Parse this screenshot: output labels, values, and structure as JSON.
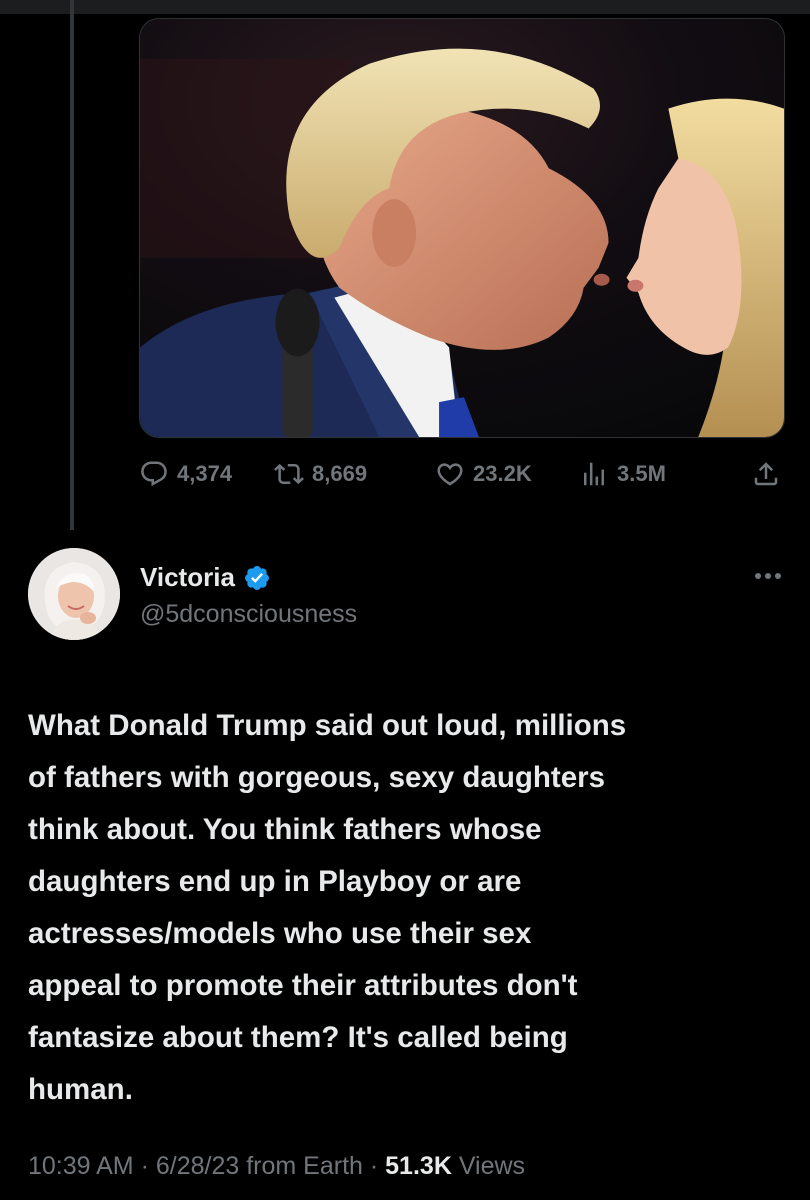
{
  "quoted_tweet": {
    "media": {
      "description_icon": "photo-icon"
    },
    "actions": {
      "replies": "4,374",
      "retweets": "8,669",
      "likes": "23.2K",
      "views": "3.5M"
    }
  },
  "tweet": {
    "author": {
      "display_name": "Victoria",
      "handle": "@5dconsciousness",
      "verified": true
    },
    "text": "What Donald Trump said out loud, millions\nof fathers with gorgeous, sexy daughters\nthink about. You think fathers whose\ndaughters end up in Playboy or are\nactresses/models who use their sex\nappeal to promote their attributes don't\nfantasize about them? It's called being\nhuman.",
    "meta": {
      "time": "10:39 AM",
      "separator1": " · ",
      "date": "6/28/23",
      "source": " from Earth",
      "separator2": " · ",
      "views_count": "51.3K",
      "views_label": " Views"
    }
  },
  "colors": {
    "background": "#000000",
    "text_primary": "#e7e9ea",
    "text_secondary": "#71767b",
    "verified_blue": "#1d9bf0"
  }
}
